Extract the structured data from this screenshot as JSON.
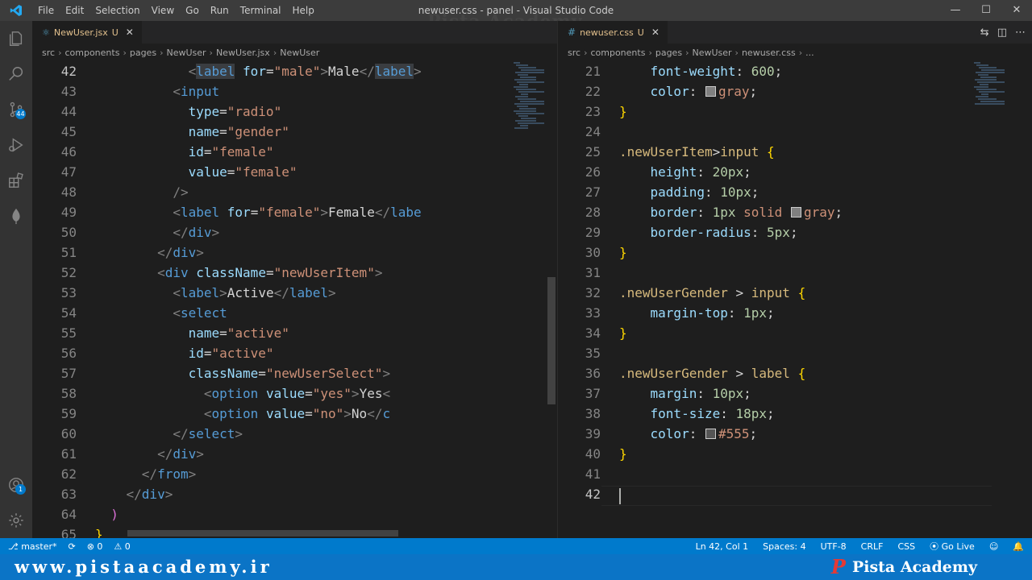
{
  "titlebar": {
    "menu": [
      "File",
      "Edit",
      "Selection",
      "View",
      "Go",
      "Run",
      "Terminal",
      "Help"
    ],
    "title": "newuser.css - panel - Visual Studio Code",
    "watermark": "Pista Academy",
    "controls": {
      "minimize": "—",
      "maximize": "☐",
      "close": "✕"
    }
  },
  "activity": {
    "icons": [
      "explorer-icon",
      "search-icon",
      "source-control-icon",
      "run-debug-icon",
      "extensions-icon",
      "mongodb-icon"
    ],
    "scm_badge": "44",
    "account_badge": "1"
  },
  "left_editor": {
    "tab": {
      "name": "NewUser.jsx",
      "status": "U",
      "close": "✕"
    },
    "breadcrumb": [
      "src",
      "components",
      "pages",
      "NewUser",
      "NewUser.jsx",
      "NewUser"
    ],
    "lines": [
      {
        "n": "42",
        "active": true,
        "tokens": [
          [
            "  ",
            "t"
          ],
          [
            "<",
            "p"
          ],
          [
            "label",
            "tag-hl"
          ],
          [
            " ",
            "t"
          ],
          [
            "for",
            "a"
          ],
          [
            "=",
            "t"
          ],
          [
            "\"male\"",
            "s"
          ],
          [
            ">",
            "p"
          ],
          [
            "Male",
            "t"
          ],
          [
            "</",
            "p"
          ],
          [
            "label",
            "tag-hl"
          ],
          [
            ">",
            "p"
          ]
        ],
        "indent": 10
      },
      {
        "n": "43",
        "tokens": [
          [
            "<",
            "p"
          ],
          [
            "input",
            "g"
          ]
        ],
        "indent": 10
      },
      {
        "n": "44",
        "tokens": [
          [
            "type",
            "a"
          ],
          [
            "=",
            "t"
          ],
          [
            "\"radio\"",
            "s"
          ]
        ],
        "indent": 12
      },
      {
        "n": "45",
        "tokens": [
          [
            "name",
            "a"
          ],
          [
            "=",
            "t"
          ],
          [
            "\"gender\"",
            "s"
          ]
        ],
        "indent": 12
      },
      {
        "n": "46",
        "tokens": [
          [
            "id",
            "a"
          ],
          [
            "=",
            "t"
          ],
          [
            "\"female\"",
            "s"
          ]
        ],
        "indent": 12
      },
      {
        "n": "47",
        "tokens": [
          [
            "value",
            "a"
          ],
          [
            "=",
            "t"
          ],
          [
            "\"female\"",
            "s"
          ]
        ],
        "indent": 12
      },
      {
        "n": "48",
        "tokens": [
          [
            "/>",
            "p"
          ]
        ],
        "indent": 10
      },
      {
        "n": "49",
        "tokens": [
          [
            "<",
            "p"
          ],
          [
            "label",
            "g"
          ],
          [
            " ",
            "t"
          ],
          [
            "for",
            "a"
          ],
          [
            "=",
            "t"
          ],
          [
            "\"female\"",
            "s"
          ],
          [
            ">",
            "p"
          ],
          [
            "Female",
            "t"
          ],
          [
            "</",
            "p"
          ],
          [
            "labe",
            "g"
          ]
        ],
        "indent": 10
      },
      {
        "n": "50",
        "tokens": [
          [
            "</",
            "p"
          ],
          [
            "div",
            "g"
          ],
          [
            ">",
            "p"
          ]
        ],
        "indent": 10
      },
      {
        "n": "51",
        "tokens": [
          [
            "</",
            "p"
          ],
          [
            "div",
            "g"
          ],
          [
            ">",
            "p"
          ]
        ],
        "indent": 8
      },
      {
        "n": "52",
        "tokens": [
          [
            "<",
            "p"
          ],
          [
            "div",
            "g"
          ],
          [
            " ",
            "t"
          ],
          [
            "className",
            "a"
          ],
          [
            "=",
            "t"
          ],
          [
            "\"newUserItem\"",
            "s"
          ],
          [
            ">",
            "p"
          ]
        ],
        "indent": 8
      },
      {
        "n": "53",
        "tokens": [
          [
            "<",
            "p"
          ],
          [
            "label",
            "g"
          ],
          [
            ">",
            "p"
          ],
          [
            "Active",
            "t"
          ],
          [
            "</",
            "p"
          ],
          [
            "label",
            "g"
          ],
          [
            ">",
            "p"
          ]
        ],
        "indent": 10
      },
      {
        "n": "54",
        "tokens": [
          [
            "<",
            "p"
          ],
          [
            "select",
            "g"
          ]
        ],
        "indent": 10
      },
      {
        "n": "55",
        "tokens": [
          [
            "name",
            "a"
          ],
          [
            "=",
            "t"
          ],
          [
            "\"active\"",
            "s"
          ]
        ],
        "indent": 12
      },
      {
        "n": "56",
        "tokens": [
          [
            "id",
            "a"
          ],
          [
            "=",
            "t"
          ],
          [
            "\"active\"",
            "s"
          ]
        ],
        "indent": 12
      },
      {
        "n": "57",
        "tokens": [
          [
            "className",
            "a"
          ],
          [
            "=",
            "t"
          ],
          [
            "\"newUserSelect\"",
            "s"
          ],
          [
            ">",
            "p"
          ]
        ],
        "indent": 12
      },
      {
        "n": "58",
        "tokens": [
          [
            "<",
            "p"
          ],
          [
            "option",
            "g"
          ],
          [
            " ",
            "t"
          ],
          [
            "value",
            "a"
          ],
          [
            "=",
            "t"
          ],
          [
            "\"yes\"",
            "s"
          ],
          [
            ">",
            "p"
          ],
          [
            "Yes",
            "t"
          ],
          [
            "<",
            "p"
          ]
        ],
        "indent": 14
      },
      {
        "n": "59",
        "tokens": [
          [
            "<",
            "p"
          ],
          [
            "option",
            "g"
          ],
          [
            " ",
            "t"
          ],
          [
            "value",
            "a"
          ],
          [
            "=",
            "t"
          ],
          [
            "\"no\"",
            "s"
          ],
          [
            ">",
            "p"
          ],
          [
            "No",
            "t"
          ],
          [
            "</",
            "p"
          ],
          [
            "c",
            "g"
          ]
        ],
        "indent": 14
      },
      {
        "n": "60",
        "tokens": [
          [
            "</",
            "p"
          ],
          [
            "select",
            "g"
          ],
          [
            ">",
            "p"
          ]
        ],
        "indent": 10
      },
      {
        "n": "61",
        "tokens": [
          [
            "</",
            "p"
          ],
          [
            "div",
            "g"
          ],
          [
            ">",
            "p"
          ]
        ],
        "indent": 8
      },
      {
        "n": "62",
        "tokens": [
          [
            "</",
            "p"
          ],
          [
            "from",
            "g"
          ],
          [
            ">",
            "p"
          ]
        ],
        "indent": 6
      },
      {
        "n": "63",
        "tokens": [
          [
            "</",
            "p"
          ],
          [
            "div",
            "g"
          ],
          [
            ">",
            "p"
          ]
        ],
        "indent": 4
      },
      {
        "n": "64",
        "tokens": [
          [
            ")",
            "bp"
          ]
        ],
        "indent": 2
      },
      {
        "n": "65",
        "tokens": [
          [
            "}",
            "by"
          ]
        ],
        "indent": 0
      }
    ]
  },
  "right_editor": {
    "tab": {
      "name": "newuser.css",
      "status": "U",
      "close": "✕"
    },
    "breadcrumb": [
      "src",
      "components",
      "pages",
      "NewUser",
      "newuser.css",
      "..."
    ],
    "lines": [
      {
        "n": "21",
        "tokens": [
          [
            "font-weight",
            "a"
          ],
          [
            ": ",
            "t"
          ],
          [
            "600",
            "n"
          ],
          [
            ";",
            "t"
          ]
        ],
        "indent": 4
      },
      {
        "n": "22",
        "tokens": [
          [
            "color",
            "a"
          ],
          [
            ": ",
            "t"
          ],
          [
            "SW:#808080",
            "sw"
          ],
          [
            "gray",
            "v"
          ],
          [
            ";",
            "t"
          ]
        ],
        "indent": 4
      },
      {
        "n": "23",
        "tokens": [
          [
            "}",
            "by"
          ]
        ],
        "indent": 0
      },
      {
        "n": "24",
        "tokens": [],
        "indent": 0
      },
      {
        "n": "25",
        "tokens": [
          [
            ".newUserItem",
            "sel"
          ],
          [
            ">",
            "t"
          ],
          [
            "input",
            "sel"
          ],
          [
            " ",
            "t"
          ],
          [
            "{",
            "by"
          ]
        ],
        "indent": 0
      },
      {
        "n": "26",
        "tokens": [
          [
            "height",
            "a"
          ],
          [
            ": ",
            "t"
          ],
          [
            "20px",
            "n"
          ],
          [
            ";",
            "t"
          ]
        ],
        "indent": 4
      },
      {
        "n": "27",
        "tokens": [
          [
            "padding",
            "a"
          ],
          [
            ": ",
            "t"
          ],
          [
            "10px",
            "n"
          ],
          [
            ";",
            "t"
          ]
        ],
        "indent": 4
      },
      {
        "n": "28",
        "tokens": [
          [
            "border",
            "a"
          ],
          [
            ": ",
            "t"
          ],
          [
            "1px",
            "n"
          ],
          [
            " ",
            "t"
          ],
          [
            "solid",
            "v"
          ],
          [
            " ",
            "t"
          ],
          [
            "SW:#808080",
            "sw"
          ],
          [
            "gray",
            "v"
          ],
          [
            ";",
            "t"
          ]
        ],
        "indent": 4
      },
      {
        "n": "29",
        "tokens": [
          [
            "border-radius",
            "a"
          ],
          [
            ": ",
            "t"
          ],
          [
            "5px",
            "n"
          ],
          [
            ";",
            "t"
          ]
        ],
        "indent": 4
      },
      {
        "n": "30",
        "tokens": [
          [
            "}",
            "by"
          ]
        ],
        "indent": 0
      },
      {
        "n": "31",
        "tokens": [],
        "indent": 0
      },
      {
        "n": "32",
        "tokens": [
          [
            ".newUserGender",
            "sel"
          ],
          [
            " > ",
            "t"
          ],
          [
            "input",
            "sel"
          ],
          [
            " ",
            "t"
          ],
          [
            "{",
            "by"
          ]
        ],
        "indent": 0
      },
      {
        "n": "33",
        "tokens": [
          [
            "margin-top",
            "a"
          ],
          [
            ": ",
            "t"
          ],
          [
            "1px",
            "n"
          ],
          [
            ";",
            "t"
          ]
        ],
        "indent": 4
      },
      {
        "n": "34",
        "tokens": [
          [
            "}",
            "by"
          ]
        ],
        "indent": 0
      },
      {
        "n": "35",
        "tokens": [],
        "indent": 0
      },
      {
        "n": "36",
        "tokens": [
          [
            ".newUserGender",
            "sel"
          ],
          [
            " > ",
            "t"
          ],
          [
            "label",
            "sel"
          ],
          [
            " ",
            "t"
          ],
          [
            "{",
            "by"
          ]
        ],
        "indent": 0
      },
      {
        "n": "37",
        "tokens": [
          [
            "margin",
            "a"
          ],
          [
            ": ",
            "t"
          ],
          [
            "10px",
            "n"
          ],
          [
            ";",
            "t"
          ]
        ],
        "indent": 4
      },
      {
        "n": "38",
        "tokens": [
          [
            "font-size",
            "a"
          ],
          [
            ": ",
            "t"
          ],
          [
            "18px",
            "n"
          ],
          [
            ";",
            "t"
          ]
        ],
        "indent": 4
      },
      {
        "n": "39",
        "tokens": [
          [
            "color",
            "a"
          ],
          [
            ": ",
            "t"
          ],
          [
            "SW:#555555",
            "sw"
          ],
          [
            "#555",
            "v"
          ],
          [
            ";",
            "t"
          ]
        ],
        "indent": 4
      },
      {
        "n": "40",
        "tokens": [
          [
            "}",
            "by"
          ]
        ],
        "indent": 0
      },
      {
        "n": "41",
        "tokens": [],
        "indent": 0
      },
      {
        "n": "42",
        "active": true,
        "tokens": [],
        "indent": 0
      }
    ]
  },
  "statusbar": {
    "branch": "master*",
    "sync": "⟳",
    "errors": "⊗ 0",
    "warnings": "⚠ 0",
    "position": "Ln 42, Col 1",
    "spaces": "Spaces: 4",
    "encoding": "UTF-8",
    "eol": "CRLF",
    "language": "CSS",
    "golive": "Go Live"
  },
  "banner": {
    "url": "www.pistaacademy.ir",
    "brand": "Pista Academy",
    "brand_mark": "P"
  },
  "colors": {
    "statusbar": "#007acc",
    "banner": "#0b74c6",
    "brand_mark": "#e53935"
  }
}
